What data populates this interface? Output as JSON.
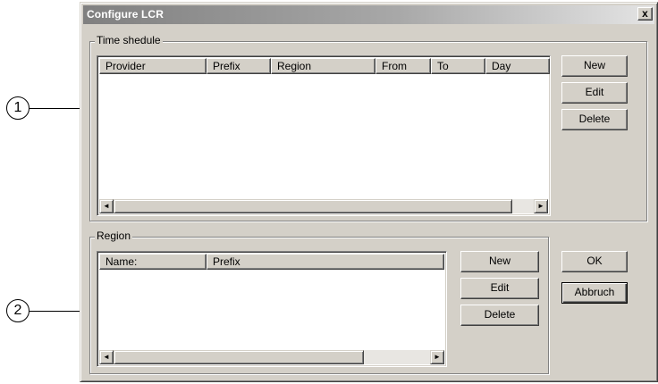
{
  "callouts": [
    "1",
    "2"
  ],
  "dialog": {
    "title": "Configure LCR",
    "close_glyph": "x"
  },
  "time_schedule": {
    "label": "Time shedule",
    "columns": [
      "Provider",
      "Prefix",
      "Region",
      "From",
      "To",
      "Day"
    ],
    "rows": [],
    "buttons": {
      "new": "New",
      "edit": "Edit",
      "delete": "Delete"
    }
  },
  "region": {
    "label": "Region",
    "columns": [
      "Name:",
      "Prefix"
    ],
    "rows": [],
    "buttons": {
      "new": "New",
      "edit": "Edit",
      "delete": "Delete"
    }
  },
  "dialog_buttons": {
    "ok": "OK",
    "cancel": "Abbruch"
  },
  "icons": {
    "scroll_left": "◄",
    "scroll_right": "►"
  }
}
